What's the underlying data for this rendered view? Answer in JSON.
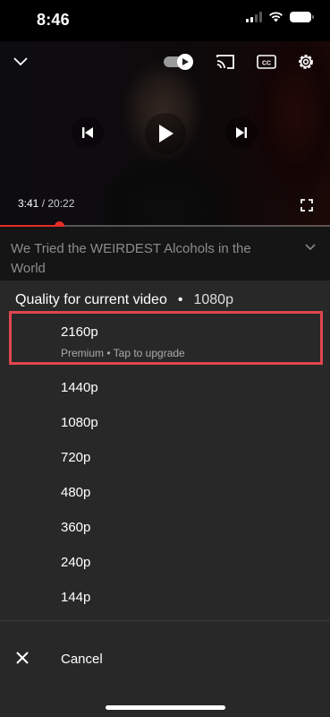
{
  "status_bar": {
    "time": "8:46",
    "icons": [
      "signal-icon",
      "wifi-icon",
      "battery-icon"
    ]
  },
  "player": {
    "current_time": "3:41",
    "separator": " / ",
    "total_time": "20:22",
    "progress_fraction": 0.18,
    "accent_color": "#e52d27",
    "controls": [
      "chevron-down-icon",
      "autoplay-toggle-icon",
      "cast-icon",
      "captions-icon",
      "settings-gear-icon",
      "previous-icon",
      "play-icon",
      "next-icon",
      "fullscreen-icon"
    ]
  },
  "video": {
    "title": "We Tried the WEIRDEST Alcohols in the World"
  },
  "quality_sheet": {
    "header_label": "Quality for current video",
    "header_dot": "•",
    "current_quality": "1080p",
    "premium_option": {
      "label": "2160p",
      "sublabel": "Premium • Tap to upgrade",
      "highlight_color": "#e0464f"
    },
    "options": [
      "1440p",
      "1080p",
      "720p",
      "480p",
      "360p",
      "240p",
      "144p"
    ],
    "cancel_label": "Cancel"
  }
}
